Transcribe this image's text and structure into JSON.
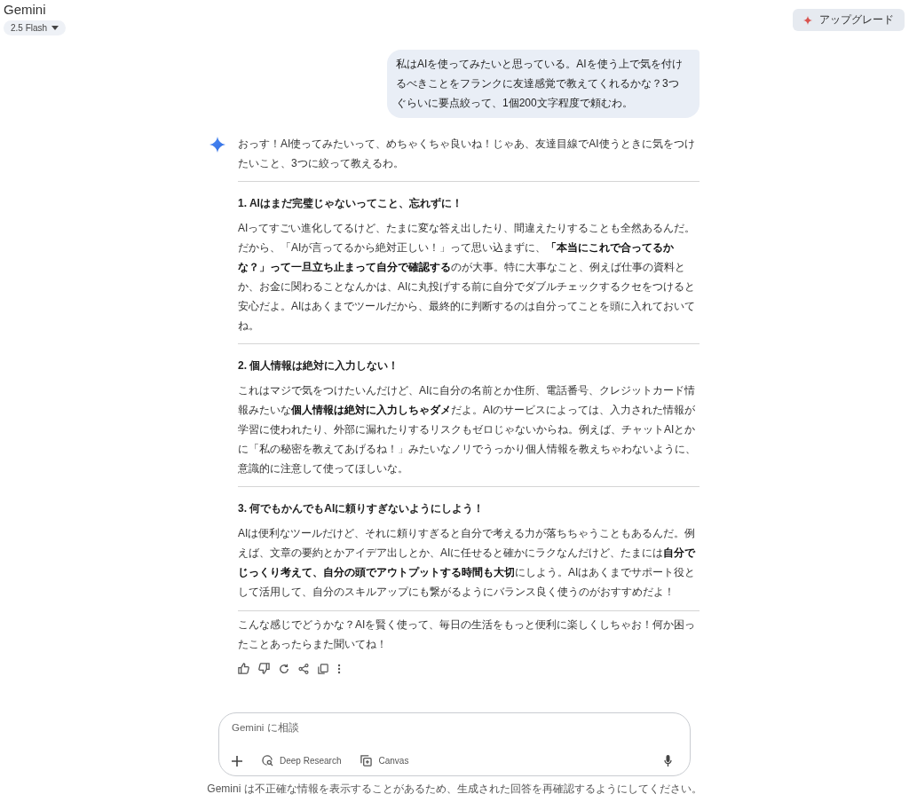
{
  "header": {
    "title": "Gemini",
    "model_selector": "2.5 Flash",
    "upgrade_button": "アップグレード"
  },
  "user_message": "私はAIを使ってみたいと思っている。AIを使う上で気を付けるべきことをフランクに友達感覚で教えてくれるかな？3つぐらいに要点絞って、1個200文字程度で頼むわ。",
  "response": {
    "intro": "おっす！AI使ってみたいって、めちゃくちゃ良いね！じゃあ、友達目線でAI使うときに気をつけたいこと、3つに絞って教えるわ。",
    "sections": [
      {
        "heading": "1. AIはまだ完璧じゃないってこと、忘れずに！",
        "body": "AIってすごい進化してるけど、たまに変な答え出したり、間違えたりすることも全然あるんだ。だから、「AIが言ってるから絶対正しい！」って思い込まずに、**「本当にこれで合ってるかな？」って一旦立ち止まって自分で確認する**のが大事。特に大事なこと、例えば仕事の資料とか、お金に関わることなんかは、AIに丸投げする前に自分でダブルチェックするクセをつけると安心だよ。AIはあくまでツールだから、最終的に判断するのは自分ってことを頭に入れておいてね。"
      },
      {
        "heading": "2. 個人情報は絶対に入力しない！",
        "body": "これはマジで気をつけたいんだけど、AIに自分の名前とか住所、電話番号、クレジットカード情報みたいな**個人情報は絶対に入力しちゃダメ**だよ。AIのサービスによっては、入力された情報が学習に使われたり、外部に漏れたりするリスクもゼロじゃないからね。例えば、チャットAIとかに「私の秘密を教えてあげるね！」みたいなノリでうっかり個人情報を教えちゃわないように、意識的に注意して使ってほしいな。"
      },
      {
        "heading": "3. 何でもかんでもAIに頼りすぎないようにしよう！",
        "body": "AIは便利なツールだけど、それに頼りすぎると自分で考える力が落ちちゃうこともあるんだ。例えば、文章の要約とかアイデア出しとか、AIに任せると確かにラクなんだけど、たまには**自分でじっくり考えて、自分の頭でアウトプットする時間も大切**にしよう。AIはあくまでサポート役として活用して、自分のスキルアップにも繋がるようにバランス良く使うのがおすすめだよ！"
      }
    ],
    "closing": "こんな感じでどうかな？AIを賢く使って、毎日の生活をもっと便利に楽しくしちゃお！何か困ったことあったらまた聞いてね！",
    "actions": [
      {
        "kind": "thumbs-up"
      },
      {
        "kind": "thumbs-down"
      },
      {
        "kind": "refresh"
      },
      {
        "kind": "share"
      },
      {
        "kind": "copy"
      },
      {
        "kind": "more"
      }
    ]
  },
  "input": {
    "placeholder": "Gemini に相談",
    "tools": [
      {
        "kind": "deep-research",
        "label": "Deep Research"
      },
      {
        "kind": "canvas",
        "label": "Canvas"
      }
    ]
  },
  "disclaimer": "Gemini は不正確な情報を表示することがあるため、生成された回答を再確認するようにしてください。"
}
